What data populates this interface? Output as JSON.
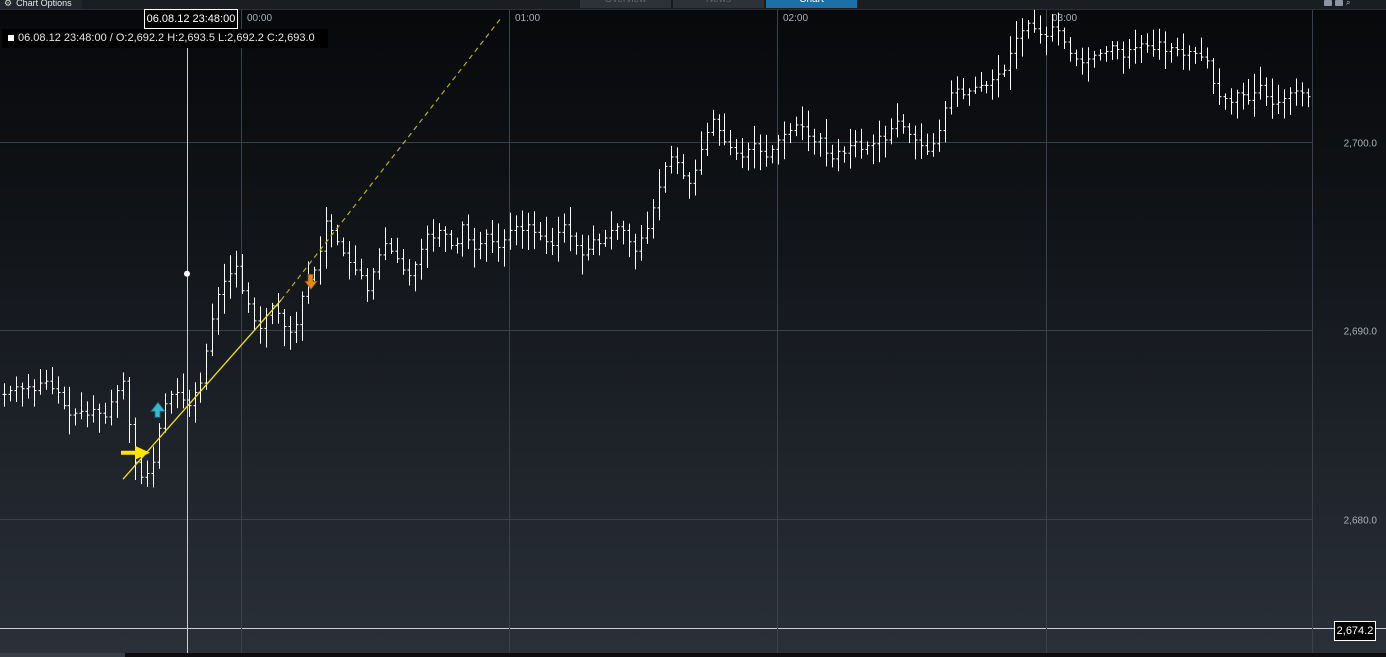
{
  "toolbar": {
    "chart_options_label": "Chart Options",
    "tabs": [
      {
        "label": "Overview",
        "active": false
      },
      {
        "label": "News",
        "active": false
      },
      {
        "label": "Chart",
        "active": true
      }
    ]
  },
  "cursor": {
    "time_label": "06.08.12 23:48:00",
    "ohlc_text": "06.08.12 23:48:00 / O:2,692.2  H:2,693.5  L:2,692.2  C:2,693.0"
  },
  "price_flag": "2,674.2",
  "colors": {
    "accent": "#1d6fa8",
    "trendline": "#f0e020",
    "buy_marker": "#39b7d1",
    "sell_marker": "#e08a1e",
    "arrow": "#ffe600"
  },
  "chart_data": {
    "type": "ohlc",
    "x_tick_labels": [
      "00:00",
      "01:00",
      "02:00",
      "03:00"
    ],
    "y_tick_labels": [
      "2,700.0",
      "2,690.0",
      "2,680.0"
    ],
    "y_ticks": [
      2700,
      2690,
      2680
    ],
    "ylim": [
      2674.2,
      2707.0
    ],
    "grid": true,
    "series": [
      {
        "values": [
          2686.6,
          2686.8,
          2687.0,
          2686.9,
          2687.0,
          2686.8,
          2687.2,
          2687.3,
          2686.9,
          2686.7,
          2686.0,
          2685.5,
          2685.6,
          2685.7,
          2685.5,
          2685.8,
          2685.6,
          2685.4,
          2686.2,
          2686.8,
          2687.3,
          2685.0,
          2683.0,
          2682.2,
          2682.4,
          2683.0,
          2684.8,
          2686.1,
          2686.6,
          2686.7,
          2686.3,
          2686.0,
          2686.7,
          2687.2,
          2688.9,
          2690.6,
          2691.9,
          2692.6,
          2693.0,
          2693.4,
          2692.1,
          2691.4,
          2690.5,
          2690.1,
          2690.8,
          2691.3,
          2690.9,
          2690.2,
          2689.9,
          2690.3,
          2691.8,
          2692.7,
          2693.2,
          2694.2,
          2695.8,
          2695.3,
          2694.7,
          2694.1,
          2693.6,
          2693.2,
          2692.9,
          2692.1,
          2693.1,
          2694.0,
          2694.6,
          2694.2,
          2693.8,
          2693.2,
          2692.9,
          2693.5,
          2694.3,
          2695.1,
          2694.9,
          2695.3,
          2695.1,
          2694.5,
          2694.6,
          2695.6,
          2694.8,
          2694.3,
          2694.6,
          2695.1,
          2694.7,
          2694.4,
          2694.8,
          2695.3,
          2695.5,
          2695.3,
          2695.6,
          2695.2,
          2695.0,
          2694.7,
          2694.5,
          2695.2,
          2695.6,
          2695.0,
          2694.5,
          2694.0,
          2694.3,
          2694.8,
          2694.6,
          2694.9,
          2695.3,
          2695.5,
          2695.3,
          2694.7,
          2694.2,
          2694.9,
          2695.4,
          2696.5,
          2697.6,
          2698.7,
          2699.2,
          2698.9,
          2698.2,
          2697.8,
          2698.5,
          2699.6,
          2700.5,
          2701.2,
          2700.6,
          2700.0,
          2699.7,
          2699.4,
          2699.2,
          2699.6,
          2699.9,
          2699.5,
          2699.2,
          2699.6,
          2700.1,
          2700.4,
          2700.6,
          2700.9,
          2700.8,
          2700.3,
          2700.0,
          2700.2,
          2699.4,
          2699.1,
          2699.5,
          2699.4,
          2699.8,
          2700.0,
          2699.6,
          2699.8,
          2699.9,
          2700.3,
          2700.1,
          2700.7,
          2701.1,
          2700.8,
          2700.4,
          2700.1,
          2699.8,
          2699.5,
          2699.9,
          2700.6,
          2701.8,
          2702.6,
          2702.8,
          2702.5,
          2702.7,
          2702.9,
          2703.0,
          2703.0,
          2703.3,
          2703.6,
          2703.8,
          2704.7,
          2705.5,
          2705.9,
          2706.3,
          2706.0,
          2705.7,
          2705.6,
          2706.1,
          2705.9,
          2705.3,
          2704.7,
          2704.4,
          2704.2,
          2704.4,
          2704.6,
          2704.7,
          2704.8,
          2705.1,
          2704.9,
          2704.5,
          2704.9,
          2705.0,
          2705.2,
          2705.1,
          2704.9,
          2705.3,
          2704.8,
          2705.0,
          2704.9,
          2704.6,
          2704.8,
          2704.7,
          2704.5,
          2704.3,
          2703.1,
          2702.4,
          2702.3,
          2702.1,
          2702.6,
          2702.5,
          2702.2,
          2702.6,
          2703.0,
          2702.4,
          2702.0,
          2702.1,
          2702.3,
          2702.6,
          2702.7,
          2702.6,
          2702.4
        ]
      }
    ],
    "annotations": {
      "trendline": [
        [
          123,
          2682.1
        ],
        [
          281,
          2691.6
        ]
      ],
      "trendline_projection": [
        [
          281,
          2691.6
        ],
        [
          500,
          2706.5
        ]
      ],
      "buy_marker": [
        158,
        2685.7
      ],
      "sell_marker": [
        311,
        2692.6
      ],
      "arrow": [
        135,
        2683.5
      ],
      "cursor_marker": [
        187,
        2693.0
      ],
      "cursor_line_x": 187
    }
  }
}
